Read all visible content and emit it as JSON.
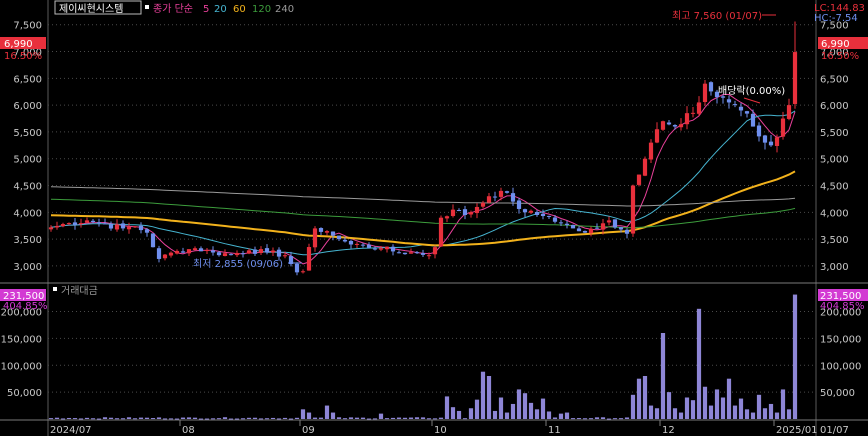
{
  "colors": {
    "up": "#e8303c",
    "down": "#6f8fee",
    "ma5": "#e8409a",
    "ma20": "#46b4d0",
    "ma60": "#f2b21c",
    "ma120": "#3c9c3c",
    "ma240": "#9a9a9a",
    "volume": "#8e86d6",
    "axis_text": "#c8c8c8",
    "grid": "#4a4a4a",
    "badge_price_bg": "#e8303c",
    "badge_volume_bg": "#d33ad3"
  },
  "header": {
    "stock_name": "제이씨현시스템",
    "ma_label": "종가 단순",
    "ma_periods": [
      "5",
      "20",
      "60",
      "120",
      "240"
    ],
    "lc_label": "LC:144.83",
    "hc_label": "HC:-7.54"
  },
  "price_panel": {
    "current_price": "6,990",
    "current_change": "16.50%",
    "high_annotation": "최고 7,560 (01/07)",
    "low_annotation": "최저 2,855 (09/06)",
    "dividend_annotation": "배당락(0.00%)"
  },
  "volume_panel": {
    "title": "거래대금",
    "current_value": "231,500",
    "current_change": "404.85%"
  },
  "chart_data": [
    {
      "type": "candlestick",
      "title": "제이씨현시스템",
      "ylim": [
        2700,
        7700
      ],
      "y_ticks": [
        3000,
        3500,
        4000,
        4500,
        5000,
        5500,
        6000,
        6500,
        7000,
        7500
      ],
      "y_tick_labels": [
        "3,000",
        "3,500",
        "4,000",
        "4,500",
        "5,000",
        "5,500",
        "6,000",
        "6,500",
        "7,000",
        "7,500"
      ],
      "x_labels": [
        "2024/07",
        "08",
        "09",
        "10",
        "11",
        "12",
        "2025/01",
        "01/07"
      ],
      "x_label_index": [
        0,
        22,
        42,
        64,
        83,
        102,
        121,
        127
      ],
      "high": {
        "value": 7560,
        "date": "01/07"
      },
      "low": {
        "value": 2855,
        "date": "09/06"
      },
      "current": 6990,
      "keypoints": [
        [
          0,
          3720
        ],
        [
          3,
          3800
        ],
        [
          6,
          3850
        ],
        [
          9,
          3780
        ],
        [
          12,
          3700
        ],
        [
          14,
          3740
        ],
        [
          16,
          3620
        ],
        [
          18,
          3130
        ],
        [
          21,
          3280
        ],
        [
          24,
          3330
        ],
        [
          27,
          3250
        ],
        [
          30,
          3220
        ],
        [
          33,
          3290
        ],
        [
          36,
          3250
        ],
        [
          39,
          3200
        ],
        [
          41,
          2880
        ],
        [
          42,
          2900
        ],
        [
          44,
          3700
        ],
        [
          46,
          3650
        ],
        [
          48,
          3500
        ],
        [
          50,
          3400
        ],
        [
          52,
          3380
        ],
        [
          55,
          3330
        ],
        [
          58,
          3250
        ],
        [
          61,
          3250
        ],
        [
          63,
          3200
        ],
        [
          64,
          3350
        ],
        [
          65,
          3900
        ],
        [
          67,
          4050
        ],
        [
          69,
          3950
        ],
        [
          71,
          4100
        ],
        [
          73,
          4300
        ],
        [
          75,
          4400
        ],
        [
          77,
          4200
        ],
        [
          79,
          4000
        ],
        [
          81,
          3950
        ],
        [
          83,
          3920
        ],
        [
          85,
          3800
        ],
        [
          87,
          3700
        ],
        [
          89,
          3620
        ],
        [
          91,
          3700
        ],
        [
          93,
          3850
        ],
        [
          95,
          3680
        ],
        [
          96,
          3600
        ],
        [
          97,
          4500
        ],
        [
          99,
          5000
        ],
        [
          100,
          5300
        ],
        [
          101,
          5550
        ],
        [
          102,
          5700
        ],
        [
          104,
          5600
        ],
        [
          106,
          5850
        ],
        [
          108,
          6050
        ],
        [
          109,
          6400
        ],
        [
          111,
          6150
        ],
        [
          113,
          6050
        ],
        [
          115,
          5900
        ],
        [
          117,
          5600
        ],
        [
          119,
          5300
        ],
        [
          120,
          5250
        ],
        [
          121,
          5400
        ],
        [
          122,
          5750
        ],
        [
          123,
          6000
        ],
        [
          124,
          6990
        ]
      ],
      "ma_series": [
        {
          "name": "5",
          "period": 5
        },
        {
          "name": "20",
          "period": 20
        },
        {
          "name": "60",
          "period": 60
        },
        {
          "name": "120",
          "period": 120
        },
        {
          "name": "240",
          "period": 240
        }
      ]
    },
    {
      "type": "bar",
      "title": "거래대금",
      "ylim": [
        0,
        240000
      ],
      "y_ticks": [
        50000,
        100000,
        150000,
        200000
      ],
      "y_tick_labels": [
        "50,000",
        "100,000",
        "150,000",
        "200,000"
      ],
      "current": 231500,
      "spikes": [
        [
          42,
          18000
        ],
        [
          43,
          12000
        ],
        [
          46,
          25000
        ],
        [
          47,
          12000
        ],
        [
          55,
          10000
        ],
        [
          66,
          42000
        ],
        [
          67,
          22000
        ],
        [
          68,
          15000
        ],
        [
          70,
          20000
        ],
        [
          71,
          36000
        ],
        [
          72,
          88000
        ],
        [
          73,
          80000
        ],
        [
          74,
          15000
        ],
        [
          75,
          40000
        ],
        [
          76,
          12000
        ],
        [
          77,
          28000
        ],
        [
          78,
          55000
        ],
        [
          79,
          48000
        ],
        [
          80,
          30000
        ],
        [
          81,
          18000
        ],
        [
          82,
          38000
        ],
        [
          83,
          14000
        ],
        [
          85,
          10000
        ],
        [
          86,
          12000
        ],
        [
          97,
          45000
        ],
        [
          98,
          75000
        ],
        [
          99,
          80000
        ],
        [
          100,
          25000
        ],
        [
          101,
          20000
        ],
        [
          102,
          160000
        ],
        [
          103,
          50000
        ],
        [
          104,
          20000
        ],
        [
          105,
          12000
        ],
        [
          106,
          40000
        ],
        [
          107,
          35000
        ],
        [
          108,
          205000
        ],
        [
          109,
          60000
        ],
        [
          110,
          25000
        ],
        [
          111,
          55000
        ],
        [
          112,
          40000
        ],
        [
          113,
          75000
        ],
        [
          114,
          25000
        ],
        [
          115,
          38000
        ],
        [
          116,
          18000
        ],
        [
          117,
          12000
        ],
        [
          118,
          45000
        ],
        [
          119,
          20000
        ],
        [
          120,
          28000
        ],
        [
          121,
          12000
        ],
        [
          122,
          55000
        ],
        [
          123,
          18000
        ],
        [
          124,
          231500
        ]
      ]
    }
  ]
}
